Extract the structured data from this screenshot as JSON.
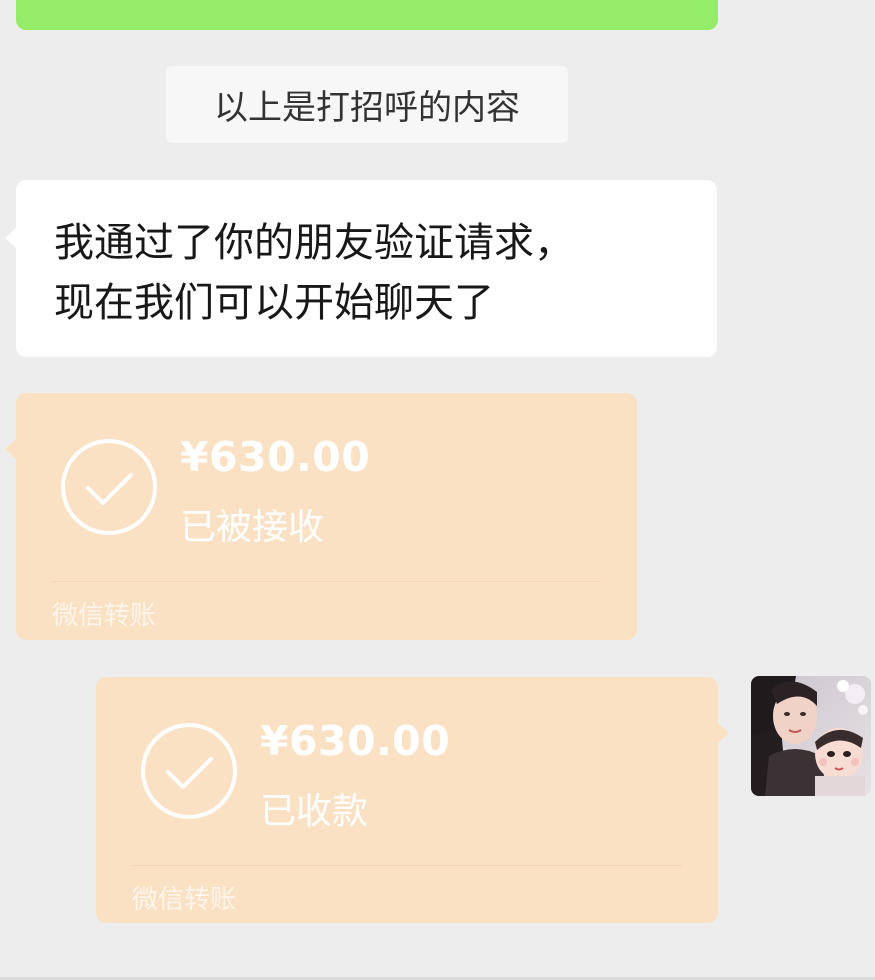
{
  "system_tip": "以上是打招呼的内容",
  "messages": {
    "friend_accepted_line1": "我通过了你的朋友验证请求，",
    "friend_accepted_line2": "现在我们可以开始聊天了"
  },
  "transfers": [
    {
      "amount": "¥630.00",
      "status": "已被接收",
      "footer": "微信转账",
      "direction": "incoming"
    },
    {
      "amount": "¥630.00",
      "status": "已收款",
      "footer": "微信转账",
      "direction": "outgoing"
    }
  ],
  "colors": {
    "background": "#ededed",
    "sent_bubble": "#95ec69",
    "received_bubble": "#ffffff",
    "transfer_bubble": "#fbe1c4"
  },
  "icons": {
    "transfer_status": "check-circle-icon",
    "avatar": "user-avatar"
  }
}
